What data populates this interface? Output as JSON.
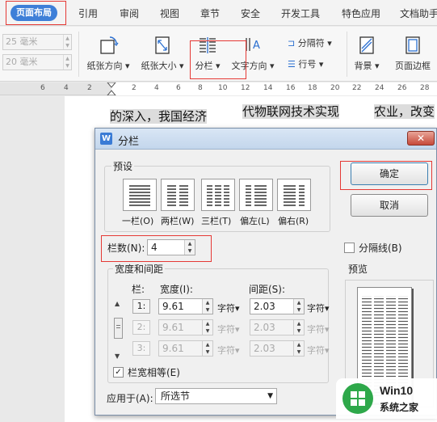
{
  "tabs": [
    "页面布局",
    "引用",
    "审阅",
    "视图",
    "章节",
    "安全",
    "开发工具",
    "特色应用",
    "文档助手"
  ],
  "ribbon": {
    "margin_fields": [
      {
        "value": "25 毫米"
      },
      {
        "value": "20 毫米"
      }
    ],
    "buttons": {
      "orientation": "纸张方向",
      "size": "纸张大小",
      "columns": "分栏",
      "text_direction": "文字方向",
      "separator": "分隔符",
      "line_number": "行号",
      "background": "背景",
      "page_border": "页面边框"
    }
  },
  "ruler": {
    "left_numbers": [
      "6",
      "4",
      "2"
    ],
    "right_numbers": [
      "2",
      "4",
      "6",
      "8",
      "10",
      "12",
      "14",
      "16",
      "18",
      "20",
      "22",
      "24",
      "26",
      "28"
    ]
  },
  "document": {
    "line1_a": "的深入，我国经济",
    "line1_b": "代物联网技术实现",
    "line1_c": "农业，改变"
  },
  "dialog": {
    "title": "分栏",
    "presets_label": "预设",
    "presets": [
      "一栏(O)",
      "两栏(W)",
      "三栏(T)",
      "偏左(L)",
      "偏右(R)"
    ],
    "ok": "确定",
    "cancel": "取消",
    "num_cols_label": "栏数(N):",
    "num_cols_value": "4",
    "separator_label": "分隔线(B)",
    "width_spacing_label": "宽度和间距",
    "preview_label": "预览",
    "col_header": "栏:",
    "width_header": "宽度(I):",
    "spacing_header": "间距(S):",
    "unit": "字符",
    "rows": [
      {
        "num": "1:",
        "width": "9.61",
        "spacing": "2.03",
        "enabled": true
      },
      {
        "num": "2:",
        "width": "9.61",
        "spacing": "2.03",
        "enabled": false
      },
      {
        "num": "3:",
        "width": "9.61",
        "spacing": "2.03",
        "enabled": false
      }
    ],
    "equal_width_label": "栏宽相等(E)",
    "equal_width_checked": "✓",
    "apply_to_label": "应用于(A):",
    "apply_to_value": "所选节"
  },
  "watermark": {
    "title": "Win10",
    "subtitle": "系统之家"
  }
}
